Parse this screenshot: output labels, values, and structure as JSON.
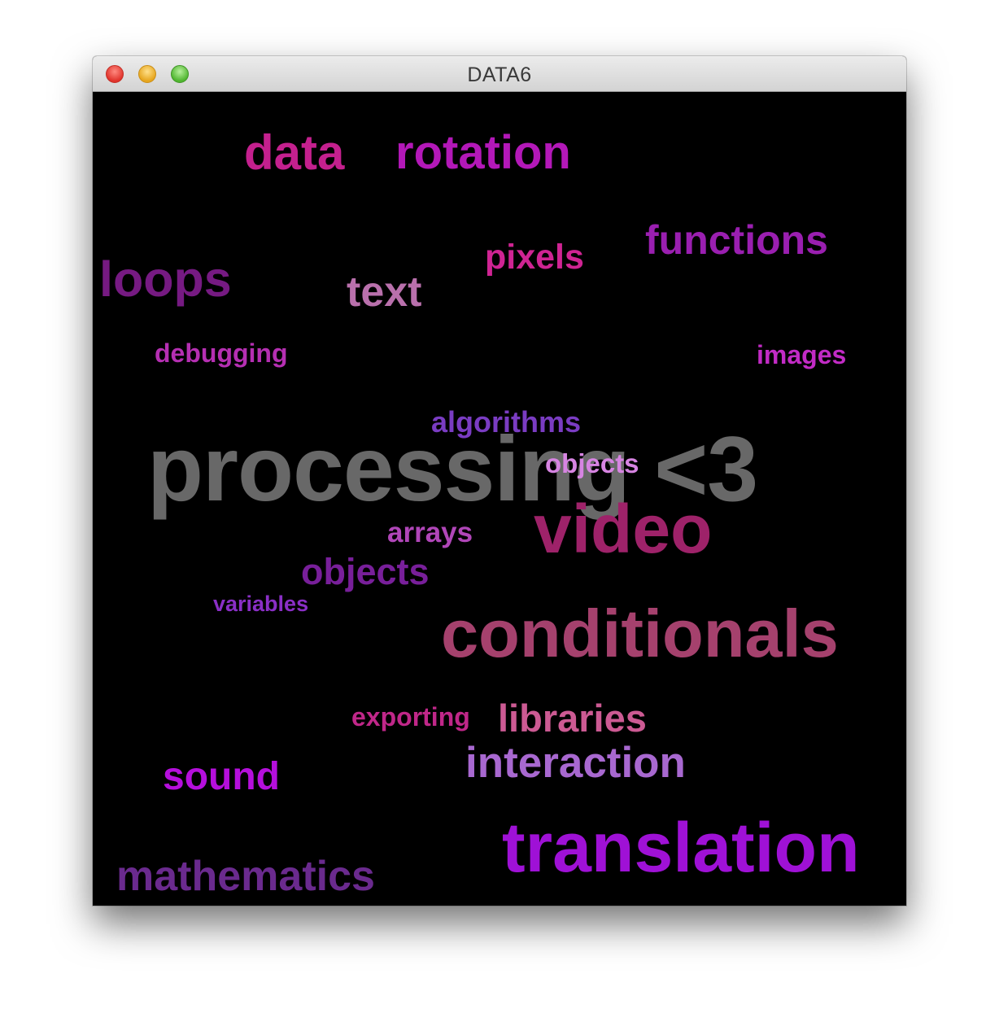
{
  "window": {
    "title": "DATA6"
  },
  "words": [
    {
      "text": "processing <3",
      "color": "#686868"
    },
    {
      "text": "data",
      "color": "#c4208e"
    },
    {
      "text": "rotation",
      "color": "#b318b8"
    },
    {
      "text": "functions",
      "color": "#9a1fb0"
    },
    {
      "text": "pixels",
      "color": "#cf2493"
    },
    {
      "text": "loops",
      "color": "#761a82"
    },
    {
      "text": "text",
      "color": "#b970ac"
    },
    {
      "text": "debugging",
      "color": "#b52fb2"
    },
    {
      "text": "images",
      "color": "#c22bc5"
    },
    {
      "text": "algorithms",
      "color": "#7a3cc2"
    },
    {
      "text": "objects",
      "color": "#d784e2"
    },
    {
      "text": "video",
      "color": "#9e2269"
    },
    {
      "text": "arrays",
      "color": "#b046b8"
    },
    {
      "text": "objects",
      "color": "#781f9a"
    },
    {
      "text": "variables",
      "color": "#8a2fc6"
    },
    {
      "text": "conditionals",
      "color": "#a5416d"
    },
    {
      "text": "exporting",
      "color": "#c02789"
    },
    {
      "text": "libraries",
      "color": "#cc5a93"
    },
    {
      "text": "interaction",
      "color": "#a868d0"
    },
    {
      "text": "sound",
      "color": "#b50fdc"
    },
    {
      "text": "translation",
      "color": "#9f11d6"
    },
    {
      "text": "mathematics",
      "color": "#6a2a8e"
    }
  ]
}
